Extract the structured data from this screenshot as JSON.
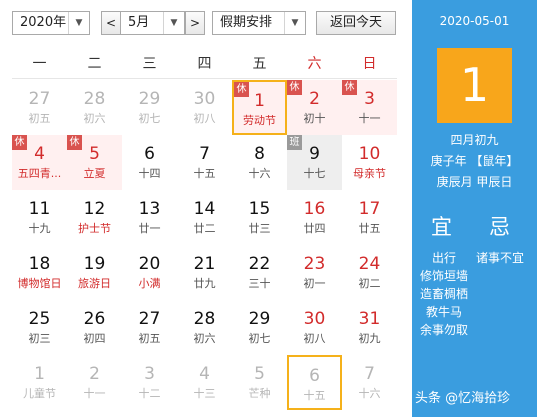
{
  "toolbar": {
    "year_value": "2020年",
    "month_value": "5月",
    "prev_symbol": "<",
    "next_symbol": ">",
    "holiday_value": "假期安排",
    "today_button": "返回今天",
    "dropdown_symbol": "▼"
  },
  "weekdays": [
    "一",
    "二",
    "三",
    "四",
    "五",
    "六",
    "日"
  ],
  "weeks": [
    [
      {
        "num": "27",
        "sub": "初五",
        "other": true
      },
      {
        "num": "28",
        "sub": "初六",
        "other": true
      },
      {
        "num": "29",
        "sub": "初七",
        "other": true
      },
      {
        "num": "30",
        "sub": "初八",
        "other": true
      },
      {
        "num": "1",
        "sub": "劳动节",
        "badge": "休",
        "holiday": true,
        "festival": true,
        "today": true,
        "we": true
      },
      {
        "num": "2",
        "sub": "初十",
        "badge": "休",
        "holiday": true,
        "we": true
      },
      {
        "num": "3",
        "sub": "十一",
        "badge": "休",
        "holiday": true,
        "we": true
      }
    ],
    [
      {
        "num": "4",
        "sub": "五四青...",
        "badge": "休",
        "holiday": true,
        "festival": true,
        "we": true
      },
      {
        "num": "5",
        "sub": "立夏",
        "badge": "休",
        "holiday": true,
        "festival": true,
        "we": true
      },
      {
        "num": "6",
        "sub": "十四"
      },
      {
        "num": "7",
        "sub": "十五"
      },
      {
        "num": "8",
        "sub": "十六"
      },
      {
        "num": "9",
        "sub": "十七",
        "badge": "班",
        "work": true
      },
      {
        "num": "10",
        "sub": "母亲节",
        "festival": true,
        "we": true
      }
    ],
    [
      {
        "num": "11",
        "sub": "十九"
      },
      {
        "num": "12",
        "sub": "护士节",
        "festival": true
      },
      {
        "num": "13",
        "sub": "廿一"
      },
      {
        "num": "14",
        "sub": "廿二"
      },
      {
        "num": "15",
        "sub": "廿三"
      },
      {
        "num": "16",
        "sub": "廿四",
        "we": true
      },
      {
        "num": "17",
        "sub": "廿五",
        "we": true
      }
    ],
    [
      {
        "num": "18",
        "sub": "博物馆日",
        "festival": true
      },
      {
        "num": "19",
        "sub": "旅游日",
        "festival": true
      },
      {
        "num": "20",
        "sub": "小满",
        "festival": true
      },
      {
        "num": "21",
        "sub": "廿九"
      },
      {
        "num": "22",
        "sub": "三十"
      },
      {
        "num": "23",
        "sub": "初一",
        "we": true
      },
      {
        "num": "24",
        "sub": "初二",
        "we": true
      }
    ],
    [
      {
        "num": "25",
        "sub": "初三"
      },
      {
        "num": "26",
        "sub": "初四"
      },
      {
        "num": "27",
        "sub": "初五"
      },
      {
        "num": "28",
        "sub": "初六"
      },
      {
        "num": "29",
        "sub": "初七"
      },
      {
        "num": "30",
        "sub": "初八",
        "we": true
      },
      {
        "num": "31",
        "sub": "初九",
        "we": true
      }
    ],
    [
      {
        "num": "1",
        "sub": "儿童节",
        "other": true,
        "festival": true
      },
      {
        "num": "2",
        "sub": "十一",
        "other": true
      },
      {
        "num": "3",
        "sub": "十二",
        "other": true
      },
      {
        "num": "4",
        "sub": "十三",
        "other": true
      },
      {
        "num": "5",
        "sub": "芒种",
        "other": true,
        "festival": true
      },
      {
        "num": "6",
        "sub": "十五",
        "other": true,
        "selected": true
      },
      {
        "num": "7",
        "sub": "十六",
        "other": true
      }
    ]
  ],
  "side": {
    "date": "2020-05-01",
    "big_day": "1",
    "lunar": "四月初九",
    "year_ganzhi": "庚子年 【鼠年】",
    "month_day_ganzhi": "庚辰月 甲辰日",
    "yi_title": "宜",
    "ji_title": "忌",
    "yi_items": [
      "出行",
      "修饰垣墙",
      "造畜椆栖",
      "教牛马",
      "余事勿取"
    ],
    "ji_items": [
      "诸事不宜"
    ]
  },
  "watermark": "头条 @忆海拾珍",
  "colors": {
    "accent_blue": "#3a9ddf",
    "today_orange": "#f8a61b",
    "weekend_red": "#d22b2b",
    "holiday_badge": "#d9534f"
  }
}
